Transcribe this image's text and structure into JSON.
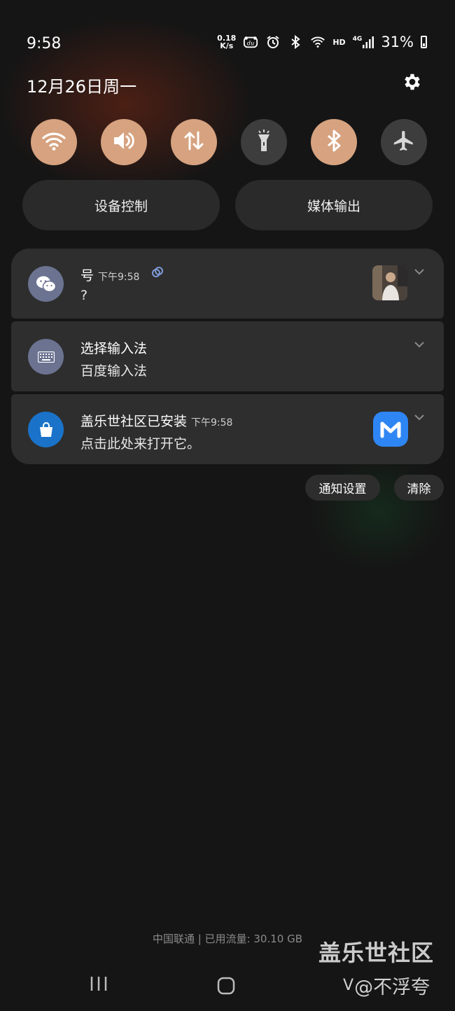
{
  "status_bar": {
    "time": "9:58",
    "net_speed_value": "0.18",
    "net_speed_unit": "K/s",
    "hd_label": "HD",
    "network_type": "4G",
    "battery_percent": "31%",
    "icons": [
      "baidu-input-icon",
      "alarm-icon",
      "bluetooth-icon",
      "wifi-icon",
      "signal-icon",
      "battery-icon"
    ]
  },
  "header": {
    "date": "12月26日周一"
  },
  "quick_settings": [
    {
      "name": "wifi",
      "icon": "wifi-icon",
      "active": true
    },
    {
      "name": "sound",
      "icon": "speaker-icon",
      "active": true
    },
    {
      "name": "mobile-data",
      "icon": "data-arrows-icon",
      "active": true
    },
    {
      "name": "flashlight",
      "icon": "flashlight-icon",
      "active": false
    },
    {
      "name": "bluetooth",
      "icon": "bluetooth-icon",
      "active": true
    },
    {
      "name": "airplane",
      "icon": "airplane-icon",
      "active": false
    }
  ],
  "panel_buttons": {
    "device_control": "设备控制",
    "media_output": "媒体输出"
  },
  "notifications": [
    {
      "app_icon": "wechat-icon",
      "title": "号",
      "time": "下午9:58",
      "body": "?"
    },
    {
      "app_icon": "keyboard-icon",
      "title": "选择输入法",
      "time": "",
      "body": "百度输入法"
    },
    {
      "app_icon": "galaxy-store-icon",
      "title": "盖乐世社区已安装",
      "time": "下午9:58",
      "body": "点击此处来打开它。"
    }
  ],
  "notification_actions": {
    "settings": "通知设置",
    "clear": "清除"
  },
  "footer": {
    "carrier_info": "中国联通 | 已用流量: 30.10 GB"
  },
  "watermark": {
    "line1": "盖乐世社区",
    "line2": "@不浮夸"
  },
  "colors": {
    "toggle_on": "#d6a27f",
    "toggle_off": "#3d3d3d",
    "card_bg": "#2e2e2e",
    "store_blue": "#1a73c9"
  }
}
